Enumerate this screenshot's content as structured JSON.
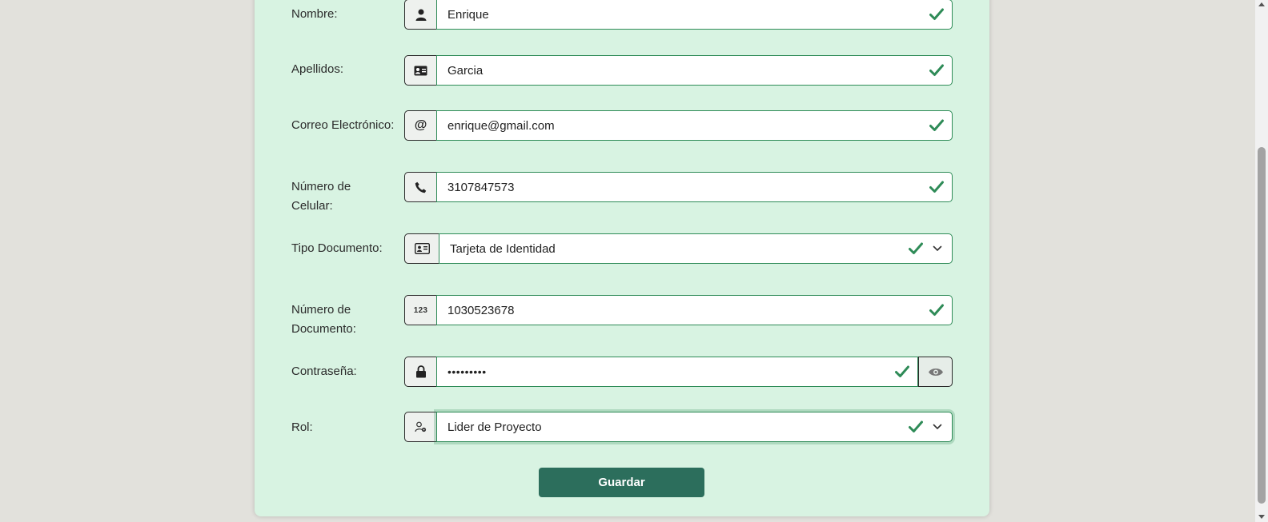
{
  "form": {
    "nombre": {
      "label": "Nombre:",
      "value": "Enrique"
    },
    "apellidos": {
      "label": "Apellidos:",
      "value": "Garcia"
    },
    "correo": {
      "label": "Correo Electrónico:",
      "value": "enrique@gmail.com"
    },
    "celular": {
      "label": "Número de Celular:",
      "value": "3107847573"
    },
    "tipo_documento": {
      "label": "Tipo Documento:",
      "value": "Tarjeta de Identidad"
    },
    "numero_documento": {
      "label": "Número de Documento:",
      "value": "1030523678",
      "icon_text": "123"
    },
    "contrasena": {
      "label": "Contraseña:",
      "value": "•••••••••"
    },
    "rol": {
      "label": "Rol:",
      "value": "Lider de Proyecto"
    },
    "submit_label": "Guardar"
  },
  "colors": {
    "card_bg": "#d8f3e2",
    "valid_green": "#2e8b57",
    "button_bg": "#2c6e5c",
    "page_bg": "#e2e1dc"
  },
  "icons": [
    "user-icon",
    "id-card-icon",
    "at-icon",
    "phone-icon",
    "id-card-icon",
    "123-icon",
    "lock-icon",
    "user-gear-icon",
    "eye-icon",
    "check-icon",
    "chevron-down-icon"
  ]
}
